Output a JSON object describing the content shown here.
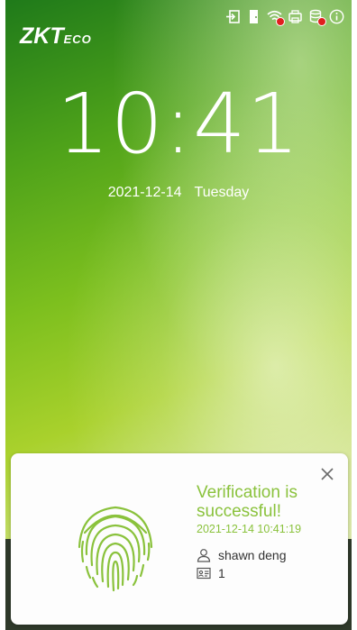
{
  "header": {
    "logo_main": "ZKT",
    "logo_suffix": "ECO",
    "status_icons": [
      "exit-icon",
      "door-icon",
      "wifi-icon",
      "printer-icon",
      "database-icon",
      "info-icon"
    ]
  },
  "clock": {
    "time": "10:41",
    "date": "2021-12-14",
    "weekday": "Tuesday"
  },
  "notification": {
    "title": "Verification is successful!",
    "timestamp": "2021-12-14 10:41:19",
    "user_name": "shawn deng",
    "user_id": "1",
    "accent_color": "#8ac23c"
  }
}
